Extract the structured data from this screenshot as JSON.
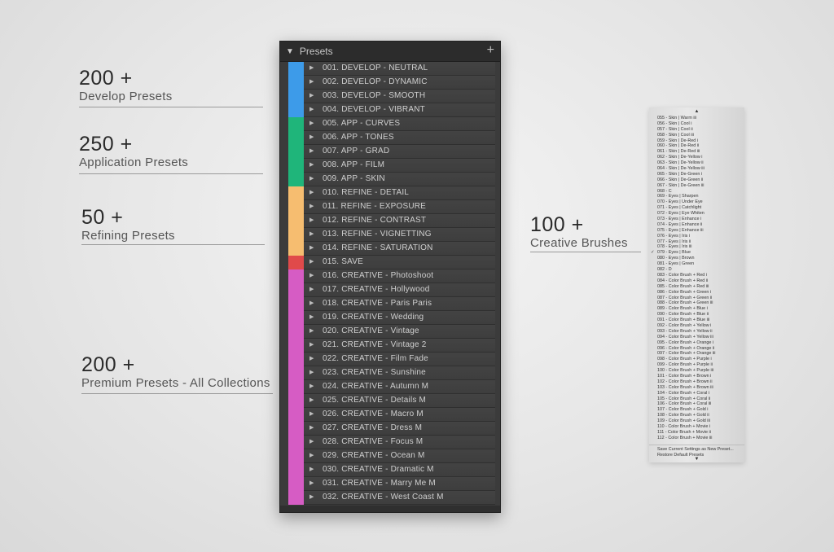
{
  "stats": [
    {
      "number": "200 +",
      "label": "Develop Presets"
    },
    {
      "number": "250 +",
      "label": "Application Presets"
    },
    {
      "number": "50 +",
      "label": "Refining Presets"
    },
    {
      "number": "200 +",
      "label": "Premium Presets - All Collections"
    },
    {
      "number": "100 +",
      "label": "Creative Brushes"
    }
  ],
  "colors": {
    "develop": "#3d9be9",
    "app": "#1fb57a",
    "refine": "#f6bd70",
    "save": "#e04a4a",
    "creative": "#d65cc4"
  },
  "presets_panel": {
    "title": "Presets",
    "collapse_icon": "triangle-down-icon",
    "add_icon": "plus-icon",
    "items": [
      {
        "label": "001. DEVELOP - NEUTRAL",
        "group": "develop"
      },
      {
        "label": "002. DEVELOP - DYNAMIC",
        "group": "develop"
      },
      {
        "label": "003. DEVELOP - SMOOTH",
        "group": "develop"
      },
      {
        "label": "004. DEVELOP - VIBRANT",
        "group": "develop"
      },
      {
        "label": "005. APP - CURVES",
        "group": "app"
      },
      {
        "label": "006. APP - TONES",
        "group": "app"
      },
      {
        "label": "007. APP - GRAD",
        "group": "app"
      },
      {
        "label": "008. APP - FILM",
        "group": "app"
      },
      {
        "label": "009. APP - SKIN",
        "group": "app"
      },
      {
        "label": "010. REFINE - DETAIL",
        "group": "refine"
      },
      {
        "label": "011. REFINE - EXPOSURE",
        "group": "refine"
      },
      {
        "label": "012. REFINE - CONTRAST",
        "group": "refine"
      },
      {
        "label": "013. REFINE - VIGNETTING",
        "group": "refine"
      },
      {
        "label": "014. REFINE - SATURATION",
        "group": "refine"
      },
      {
        "label": "015. SAVE",
        "group": "save"
      },
      {
        "label": "016. CREATIVE - Photoshoot",
        "group": "creative"
      },
      {
        "label": "017. CREATIVE - Hollywood",
        "group": "creative"
      },
      {
        "label": "018. CREATIVE - Paris Paris",
        "group": "creative"
      },
      {
        "label": "019. CREATIVE - Wedding",
        "group": "creative"
      },
      {
        "label": "020. CREATIVE - Vintage",
        "group": "creative"
      },
      {
        "label": "021. CREATIVE - Vintage 2",
        "group": "creative"
      },
      {
        "label": "022. CREATIVE - Film Fade",
        "group": "creative"
      },
      {
        "label": "023. CREATIVE - Sunshine",
        "group": "creative"
      },
      {
        "label": "024. CREATIVE - Autumn M",
        "group": "creative"
      },
      {
        "label": "025. CREATIVE - Details M",
        "group": "creative"
      },
      {
        "label": "026. CREATIVE - Macro M",
        "group": "creative"
      },
      {
        "label": "027. CREATIVE - Dress M",
        "group": "creative"
      },
      {
        "label": "028. CREATIVE - Focus M",
        "group": "creative"
      },
      {
        "label": "029. CREATIVE - Ocean M",
        "group": "creative"
      },
      {
        "label": "030. CREATIVE - Dramatic M",
        "group": "creative"
      },
      {
        "label": "031. CREATIVE - Marry Me M",
        "group": "creative"
      },
      {
        "label": "032. CREATIVE - West Coast M",
        "group": "creative"
      }
    ]
  },
  "brush_menu": {
    "scroll_up": "▲",
    "scroll_down": "▼",
    "items": [
      {
        "label": "055 - Skin | Warm iii"
      },
      {
        "label": "056 - Skin | Cool i"
      },
      {
        "label": "057 - Skin | Cool ii"
      },
      {
        "label": "058 - Skin | Cool iii"
      },
      {
        "label": "059 - Skin | De-Red i"
      },
      {
        "label": "060 - Skin | De-Red ii"
      },
      {
        "label": "061 - Skin | De-Red iii"
      },
      {
        "label": "062 - Skin | De-Yellow i"
      },
      {
        "label": "063 - Skin | De-Yellow ii"
      },
      {
        "label": "064 - Skin | De-Yellow iii"
      },
      {
        "label": "065 - Skin | De-Green i"
      },
      {
        "label": "066 - Skin | De-Green ii"
      },
      {
        "label": "067 - Skin | De-Green iii"
      },
      {
        "label": "068 - C"
      },
      {
        "label": "069 - Eyes | Sharpen"
      },
      {
        "label": "070 - Eyes | Under Eye"
      },
      {
        "label": "071 - Eyes | Catchlight"
      },
      {
        "label": "072 - Eyes | Eye Whiten"
      },
      {
        "label": "073 - Eyes | Enhance i"
      },
      {
        "label": "074 - Eyes | Enhance ii"
      },
      {
        "label": "075 - Eyes | Enhance iii"
      },
      {
        "label": "076 - Eyes | Iris i"
      },
      {
        "label": "077 - Eyes | Iris ii"
      },
      {
        "label": "078 - Eyes | Iris iii"
      },
      {
        "label": "079 - Eyes | Blue",
        "checked": "✓"
      },
      {
        "label": "080 - Eyes | Brown"
      },
      {
        "label": "081 - Eyes | Green"
      },
      {
        "label": "082 - D"
      },
      {
        "label": "083 - Color Brush + Red i"
      },
      {
        "label": "084 - Color Brush + Red ii"
      },
      {
        "label": "085 - Color Brush + Red iii"
      },
      {
        "label": "086 - Color Brush + Green i"
      },
      {
        "label": "087 - Color Brush + Green ii"
      },
      {
        "label": "088 - Color Brush + Green iii"
      },
      {
        "label": "089 - Color Brush + Blue i"
      },
      {
        "label": "090 - Color Brush + Blue ii"
      },
      {
        "label": "091 - Color Brush + Blue iii"
      },
      {
        "label": "092 - Color Brush + Yellow i"
      },
      {
        "label": "093 - Color Brush + Yellow ii"
      },
      {
        "label": "094 - Color Brush + Yellow iii"
      },
      {
        "label": "095 - Color Brush + Orange i"
      },
      {
        "label": "096 - Color Brush + Orange ii"
      },
      {
        "label": "097 - Color Brush + Orange iii"
      },
      {
        "label": "098 - Color Brush + Purple i"
      },
      {
        "label": "099 - Color Brush + Purple ii"
      },
      {
        "label": "100 - Color Brush + Purple iii"
      },
      {
        "label": "101 - Color Brush + Brown i"
      },
      {
        "label": "102 - Color Brush + Brown ii"
      },
      {
        "label": "103 - Color Brush + Brown iii"
      },
      {
        "label": "104 - Color Brush + Coral i"
      },
      {
        "label": "105 - Color Brush + Coral ii"
      },
      {
        "label": "106 - Color Brush + Coral iii"
      },
      {
        "label": "107 - Color Brush + Gold i"
      },
      {
        "label": "108 - Color Brush + Gold ii"
      },
      {
        "label": "109 - Color Brush + Gold iii"
      },
      {
        "label": "110 - Color Brush + Movie i"
      },
      {
        "label": "111 - Color Brush + Movie ii"
      },
      {
        "label": "112 - Color Brush + Movie iii"
      }
    ],
    "actions": [
      {
        "label": "Save Current Settings as New Preset..."
      },
      {
        "label": "Restore Default Presets"
      }
    ]
  }
}
